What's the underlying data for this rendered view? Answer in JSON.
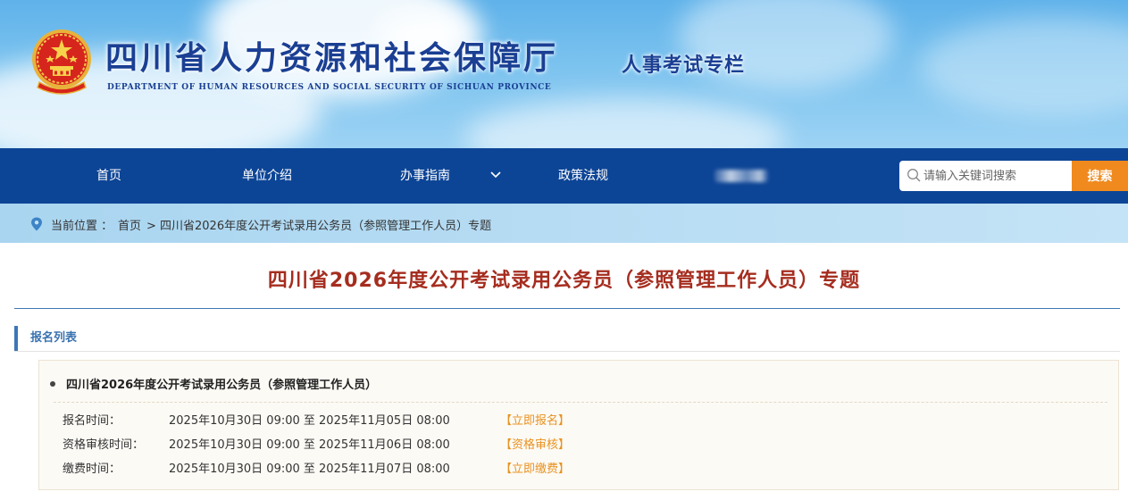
{
  "header": {
    "org_name": "四川省人力资源和社会保障厅",
    "org_name_en": "DEPARTMENT OF HUMAN RESOURCES AND SOCIAL SECURITY OF SICHUAN PROVINCE",
    "column_title": "人事考试专栏",
    "emblem_icon": "national-emblem-icon"
  },
  "nav": {
    "items": [
      {
        "label": "首页"
      },
      {
        "label": "单位介绍"
      },
      {
        "label": "办事指南",
        "icon": "chevron-down-icon"
      },
      {
        "label": "政策法规"
      }
    ],
    "search": {
      "placeholder": "请输入关键词搜索",
      "value": "",
      "button_label": "搜索",
      "icon": "search-icon"
    },
    "colors": {
      "nav_bg": "#0d4596",
      "search_button": "#f08a1e"
    }
  },
  "breadcrumb": {
    "icon": "location-pin-icon",
    "prefix": "当前位置 ：",
    "home": "首页",
    "separator": ">",
    "current": "四川省2026年度公开考试录用公务员（参照管理工作人员）专题"
  },
  "main": {
    "page_title": "四川省2026年度公开考试录用公务员（参照管理工作人员）专题",
    "section_title": "报名列表",
    "card": {
      "title": "四川省2026年度公开考试录用公务员（参照管理工作人员）",
      "rows": [
        {
          "label": "报名时间：",
          "time": "2025年10月30日 09:00 至 2025年11月05日 08:00",
          "action": "【立即报名】"
        },
        {
          "label": "资格审核时间：",
          "time": "2025年10月30日 09:00 至 2025年11月06日 08:00",
          "action": "【资格审核】"
        },
        {
          "label": "缴费时间：",
          "time": "2025年10月30日 09:00 至 2025年11月07日 08:00",
          "action": "【立即缴费】"
        }
      ]
    },
    "colors": {
      "title": "#a52d1f",
      "accent": "#3a72b0",
      "action": "#e89220"
    }
  }
}
